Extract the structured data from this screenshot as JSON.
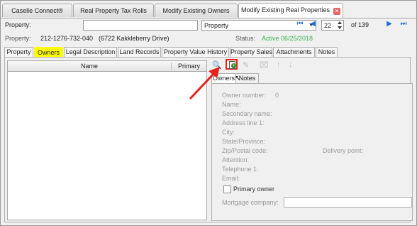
{
  "doc_tabs": [
    "Caselle Connect®",
    "Real Property Tax Rolls",
    "Modify Existing Owners",
    "Modify Existing Real Properties"
  ],
  "toolbar": {
    "property_label": "Property:",
    "property_input": "",
    "search_field": "Property",
    "record_current": "22",
    "record_total": "of 139"
  },
  "info": {
    "property_label": "Property:",
    "property_value": "212-1276-732-040",
    "address": "(6722 Kakkleberry Drive)",
    "status_label": "Status:",
    "status_value": "Active 06/25/2018"
  },
  "sub_tabs": [
    "Property",
    "Owners",
    "Legal Description",
    "Land Records",
    "Property Value History",
    "Property Sales",
    "Attachments",
    "Notes"
  ],
  "grid": {
    "col_name": "Name",
    "col_primary": "Primary"
  },
  "inner_tabs": [
    "Owners",
    "Notes"
  ],
  "owner_form": {
    "owner_number_label": "Owner number:",
    "owner_number_value": "0",
    "name": "Name:",
    "secondary_name": "Secondary name:",
    "address1": "Address line 1:",
    "city": "City:",
    "state": "State/Province:",
    "zip": "Zip/Postal code:",
    "delivery_point": "Delivery point:",
    "attention": "Attention:",
    "telephone": "Telephone 1:",
    "email": "Email:",
    "primary_owner": "Primary owner",
    "mortgage": "Mortgage company:"
  },
  "colors": {
    "status_green": "#3ab34a",
    "highlight_yellow": "#ffff00",
    "callout_red": "#e8201a"
  }
}
